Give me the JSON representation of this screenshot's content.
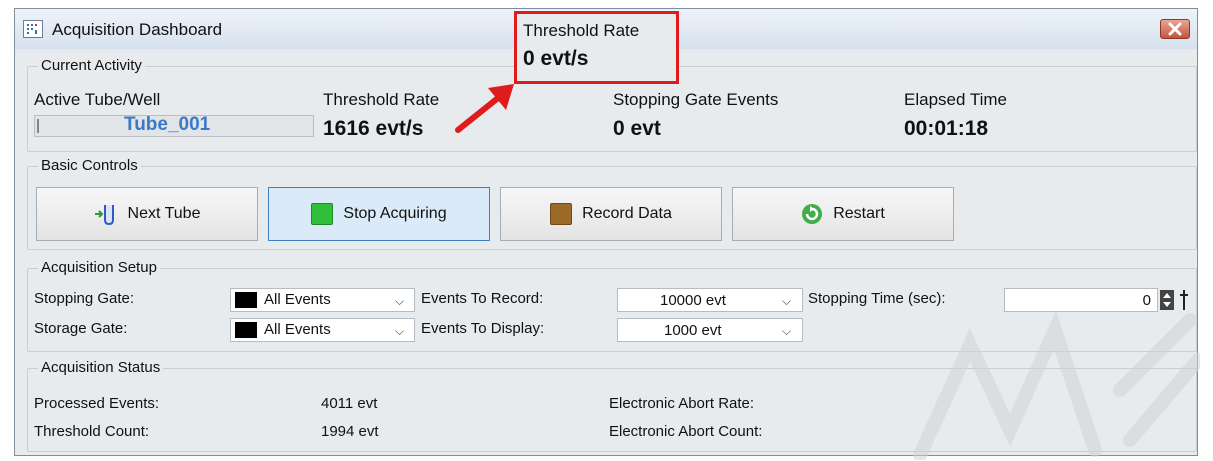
{
  "window": {
    "title": "Acquisition Dashboard",
    "close_icon": "close-icon"
  },
  "callout": {
    "label": "Threshold Rate",
    "value": "0 evt/s",
    "color": "#e01b1b"
  },
  "current_activity": {
    "heading": "Current Activity",
    "tube_label": "Active Tube/Well",
    "tube_value": "Tube_001",
    "rate_label": "Threshold Rate",
    "rate_value": "1616 evt/s",
    "stop_label": "Stopping Gate Events",
    "stop_value": "0 evt",
    "elapsed_label": "Elapsed Time",
    "elapsed_value": "00:01:18"
  },
  "basic_controls": {
    "heading": "Basic Controls",
    "next": "Next Tube",
    "stop": "Stop Acquiring",
    "record": "Record Data",
    "restart": "Restart"
  },
  "setup": {
    "heading": "Acquisition Setup",
    "stopping_gate_label": "Stopping Gate:",
    "stopping_gate_value": "All Events",
    "storage_gate_label": "Storage Gate:",
    "storage_gate_value": "All Events",
    "events_record_label": "Events To Record:",
    "events_record_value": "10000 evt",
    "events_display_label": "Events To Display:",
    "events_display_value": "1000 evt",
    "stopping_time_label": "Stopping Time (sec):",
    "stopping_time_value": "0"
  },
  "status": {
    "heading": "Acquisition Status",
    "processed_label": "Processed Events:",
    "processed_value": "4011 evt",
    "threshold_label": "Threshold Count:",
    "threshold_value": "1994 evt",
    "abort_rate_label": "Electronic Abort Rate:",
    "abort_count_label": "Electronic Abort Count:"
  }
}
